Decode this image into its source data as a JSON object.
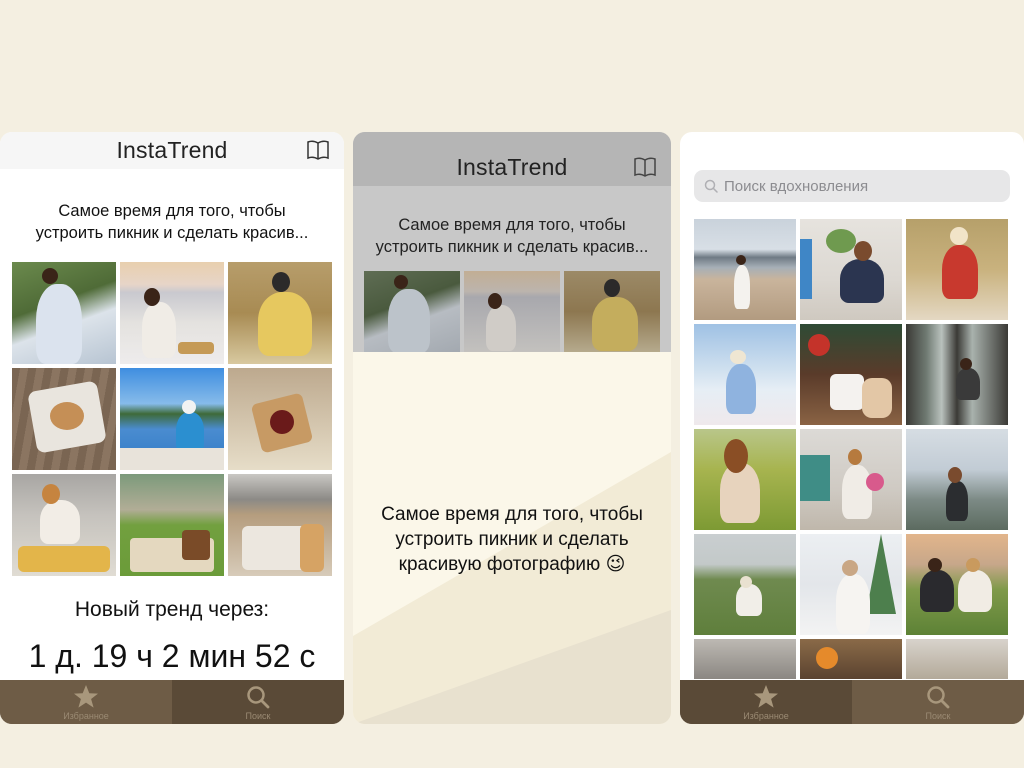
{
  "app": {
    "title": "InstaTrend"
  },
  "screen1": {
    "headline_line1": "Самое время для того, чтобы",
    "headline_line2": "устроить пикник и сделать красив...",
    "countdown_label": "Новый тренд через:",
    "countdown_value": "1 д. 19 ч 2 мин 52 с"
  },
  "screen2": {
    "headline_line1": "Самое время для того, чтобы",
    "headline_line2": "устроить пикник и сделать красив...",
    "onboard_line1": "Самое время для того, чтобы",
    "onboard_line2": "устроить пикник и сделать",
    "onboard_line3": "красивую фотографию 😉"
  },
  "screen3": {
    "search_placeholder": "Поиск вдохновления"
  },
  "tabbar": {
    "favorites_label": "Избранное",
    "search_label": "Поиск"
  },
  "colors": {
    "background": "#f4efe1",
    "tabbar": "#6e5c46",
    "tabbar_inactive": "#5a4a37",
    "tab_icon": "#a8977c"
  },
  "icons": [
    "book-icon",
    "star-icon",
    "search-icon"
  ]
}
